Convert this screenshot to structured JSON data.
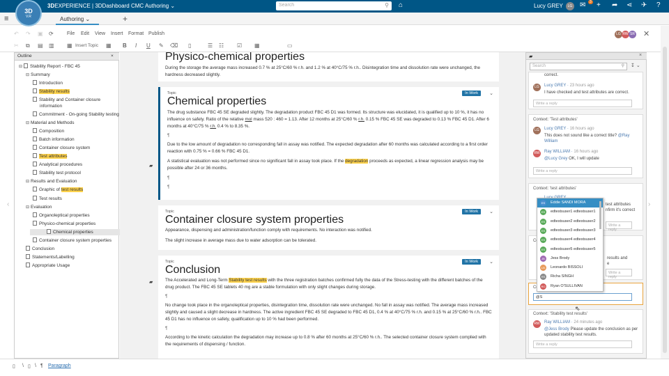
{
  "header": {
    "logo_main": "3D",
    "logo_sub": "V.R",
    "brand_bold": "3D",
    "brand_text": "EXPERIENCE | 3DDashboard",
    "app_name": "CMC Authoring",
    "dropdown_glyph": "⌄",
    "search_placeholder": "Search",
    "user_name": "Lucy GREY",
    "user_initials": "LG",
    "notification_count": "3"
  },
  "tabs": {
    "active": "Authoring",
    "dropdown_glyph": "⌄",
    "add_glyph": "+"
  },
  "menu": [
    "File",
    "Edit",
    "View",
    "Insert",
    "Format",
    "Publish"
  ],
  "toolbar": {
    "insert_topic": "Insert Topic",
    "bold": "B",
    "italic": "I",
    "underline": "U"
  },
  "collaborators": [
    {
      "initials": "LG",
      "color": "#a0705a"
    },
    {
      "initials": "RW",
      "color": "#d25b5b"
    },
    {
      "initials": "SR",
      "color": "#8a6db3"
    }
  ],
  "outline": {
    "tab_label": "Outline",
    "close_glyph": "×",
    "items": [
      {
        "label": "Stability Report - FBC 45",
        "level": 0,
        "toggle": "⊟"
      },
      {
        "label": "Summary",
        "level": 1,
        "toggle": "⊟"
      },
      {
        "label": "Introduction",
        "level": 2
      },
      {
        "label": "Stability results",
        "level": 2,
        "highlight": true
      },
      {
        "label": "Stability and Container closure",
        "label2": "information",
        "level": 2
      },
      {
        "label": "Commitment - On-going Stability testing",
        "level": 2
      },
      {
        "label": "Material and Methods",
        "level": 1,
        "toggle": "⊟"
      },
      {
        "label": "Composition",
        "level": 2
      },
      {
        "label": "Batch information",
        "level": 2
      },
      {
        "label": "Container closure system",
        "level": 2
      },
      {
        "label": "Test attributes",
        "level": 2,
        "highlight": true
      },
      {
        "label": "Analytical procedures",
        "level": 2
      },
      {
        "label": "Stability test protocol",
        "level": 2
      },
      {
        "label": "Results and Evaluation",
        "level": 1,
        "toggle": "⊟"
      },
      {
        "label": "Graphic of ",
        "hl_part": "test results",
        "level": 2
      },
      {
        "label": "Test results",
        "level": 2
      },
      {
        "label": "Evaluation",
        "level": 1,
        "toggle": "⊟"
      },
      {
        "label": "Organoleptical properties",
        "level": 2
      },
      {
        "label": "Physico-chemical properties",
        "level": 2
      },
      {
        "label": "Chemical properties",
        "level": 2,
        "selected": true
      },
      {
        "label": "Container closure system properties",
        "level": 2
      },
      {
        "label": "Conclusion",
        "level": 1
      },
      {
        "label": "Statements/Labelling",
        "level": 1
      },
      {
        "label": "Appropriate Usage",
        "level": 1
      }
    ]
  },
  "document": {
    "physico": {
      "title": "Physico-chemical properties",
      "text": "During the storage the average mass increased 0.7 % at 25°C/60 % r.h. and 1.2 % at 40°C/75 % r.h.. Disintegration time and dissolution rate were unchanged, the hardness decreased slightly."
    },
    "chemical": {
      "topic": "Topic",
      "status": "In Work",
      "title": "Chemical properties",
      "p1a": "The drug substance FBC 45 SE degraded slightly. The degradation product FBC 45 D1 was formed. Its structure was elucidated, it is qualified up to 10 %, it has no influence on safety. Ratio of the relative ",
      "p1_mol": "mol",
      "p1b": " mass 520 : 460 = 1.13. After 12 months at 25°C/60 % ",
      "p1_rh": "r.h.",
      "p1c": " 0.15 % FBC 45 SE was degraded to 0.13 % FBC 45 D1. After 6 months at 40°C/75 % ",
      "p1_rh2": "r.h.",
      "p1d": " 0.4 % to 8.35 %.",
      "pilcrow": "¶",
      "p2": "Due to the low amount of degradation no corresponding fall in assay was notified. The expected degradation after 60 months was calculated according to a first order reaction with 0.75 % = 0.66 % FBC 45 D1.",
      "p3a": "A statistical evaluation was not performed since no significant fall in assay took place. If the ",
      "p3_hl": "degradation",
      "p3b": " proceeds as expected, a linear regression analysis may be possible after 24 or 36 months."
    },
    "container": {
      "topic": "Topic",
      "status": "In Work",
      "title": "Container closure system properties",
      "p1": "Appearance, dispensing and administration/function comply with requirements. No interaction was notified.",
      "p2": "The slight increase in average mass due to water adsorption can be tolerated."
    },
    "conclusion": {
      "topic": "Topic",
      "status": "In Work",
      "title": "Conclusion",
      "p1a": "The Accelerated and Long-Term ",
      "p1_hl": "Stability test results",
      "p1b": " with the three registration batches confirmed fully the data of the Stress-testing with the different batches of the drug product. The FBC 45 SE tablets 40 mg are a stable formulation with only slight changes during storage.",
      "p2": "No change took place in the organoleptical properties, disintegration time, dissolution rate were unchanged. No fall in assay was notified. The average mass increased slightly and caused a slight decrease in hardness. The active ingredient FBC 45 SE degraded to FBC 45 D1, 0.4 % at 40°C/75 % r.h. and 0.15 % at 25°C/60 % r.h.. FBC 45 D1 has no influence on safety, qualification up to 10 % had been performed.",
      "p3": "According to the kinetic calculation the degradation may increase up to 0.8 % after 60 months at 25°C/60 % r.h.. The selected container closure system complied with the requirements of dispensing / function."
    }
  },
  "comments": {
    "search_placeholder": "Search",
    "sort_glyph": "↧",
    "threads": [
      {
        "partial_text": "correct.",
        "author": "Lucy GREY",
        "time": "23 hours ago",
        "text": "I have checked and test attributes are correct.",
        "reply": "Write a reply"
      },
      {
        "context": "Context: 'Test attributes'",
        "author1": "Lucy GREY",
        "time1": "16 hours ago",
        "text1a": "This does not sound like a correct title? ",
        "text1_mention": "@Ray William",
        "author2": "Ray WILLIAM",
        "time2": "16 hours ago",
        "text2_mention": "@Lucy Grey",
        "text2b": " OK, I will update",
        "reply": "Write a reply"
      },
      {
        "context": "Context: 'test attributes'",
        "author_partial": "Lucy GREY",
        "text_partial1": "test attributes",
        "text_partial2": "nfirm it's correct",
        "reply": "Write a reply"
      },
      {
        "context_partial": "Co",
        "text_partial1": "results and",
        "text_partial2": "e",
        "reply": "Write a reply"
      },
      {
        "context_partial": "Co",
        "reply_value": "@S"
      },
      {
        "context": "Context: 'Stability test results'",
        "author": "Ray WILLIAM",
        "time": "24 minutes ago",
        "text_mention": "@Jess Brody",
        "text_b": " Please update the conclusion as per updated stability test results.",
        "reply": "Write a reply"
      }
    ]
  },
  "mention_dropdown": [
    {
      "initials": "ES",
      "label": "Eddie SANDI MORA",
      "color": "#4a8fd0",
      "selected": true
    },
    {
      "initials": "ES",
      "label": "edtestsuser1 edtestsuser1",
      "color": "#5aaa5a"
    },
    {
      "initials": "ES",
      "label": "edtestsuser2 edtestsuser2",
      "color": "#5aaa5a"
    },
    {
      "initials": "ES",
      "label": "edtestsuser3 edtestsuser3",
      "color": "#5aaa5a"
    },
    {
      "initials": "ES",
      "label": "edtestsuser4 edtestsuser4",
      "color": "#5aaa5a"
    },
    {
      "initials": "ES",
      "label": "edtestsuser5 edtestsuser5",
      "color": "#5aaa5a"
    },
    {
      "initials": "JB",
      "label": "Jess Brody",
      "color": "#a06ab3"
    },
    {
      "initials": "LB",
      "label": "Leonardo BISSOLI",
      "color": "#e89a5a"
    },
    {
      "initials": "RS",
      "label": "Richa SINGH",
      "color": "#8a8a8a"
    },
    {
      "initials": "RO",
      "label": "Ryan O'SULLIVAN",
      "color": "#d25b5b"
    }
  ],
  "breadcrumb": {
    "sep": "\\",
    "paragraph": "Paragraph"
  }
}
